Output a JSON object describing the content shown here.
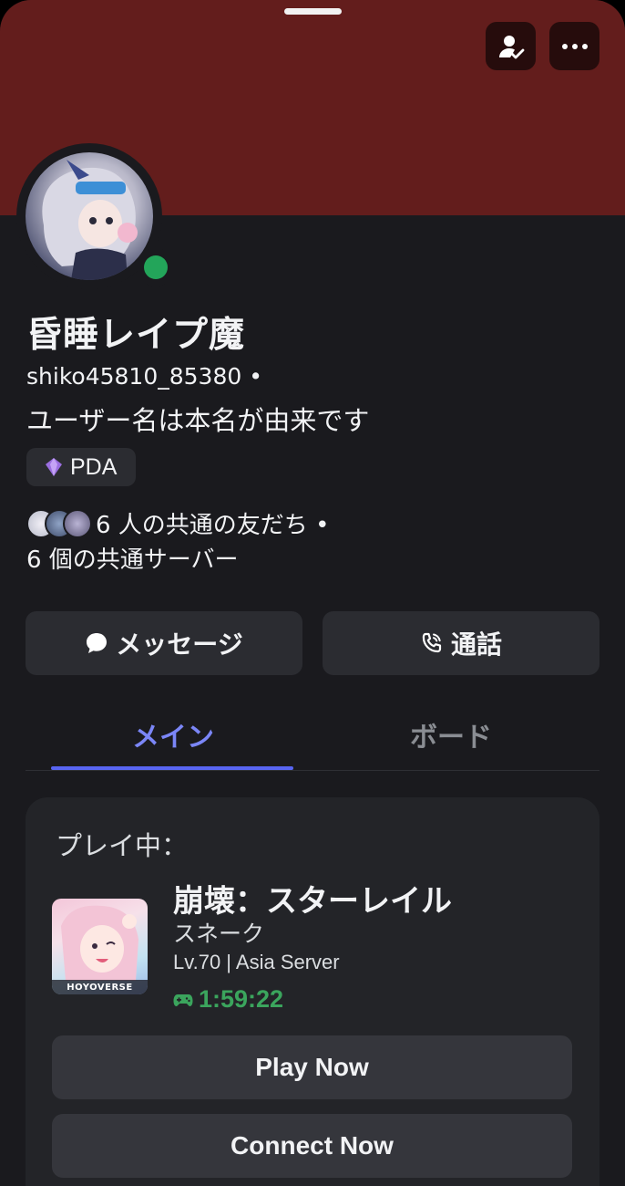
{
  "header": {
    "colors": {
      "banner": "#631d1c",
      "status_online": "#23a55a",
      "accent": "#5865f2",
      "timer": "#3ba55d"
    },
    "add_friend_icon": "person-check-icon",
    "more_icon": "more-horizontal-icon"
  },
  "profile": {
    "display_name": "昏睡レイプ魔",
    "username": "shiko45810_85380 •",
    "pronouns": "ユーザー名は本名が由来です",
    "tag_label": "PDA",
    "mutual_friends": "6 人の共通の友だち •",
    "mutual_servers": "6 個の共通サーバー"
  },
  "actions": {
    "message_label": "メッセージ",
    "call_label": "通話"
  },
  "tabs": [
    {
      "label": "メイン",
      "active": true
    },
    {
      "label": "ボード",
      "active": false
    }
  ],
  "activity": {
    "heading": "プレイ中：",
    "game_title": "崩壊：スターレイル",
    "details": "スネーク",
    "state": "Lv.70 | Asia Server",
    "elapsed": "1:59:22",
    "publisher_logo_text": "HOYOVERSE",
    "play_button": "Play Now",
    "connect_button": "Connect Now"
  }
}
